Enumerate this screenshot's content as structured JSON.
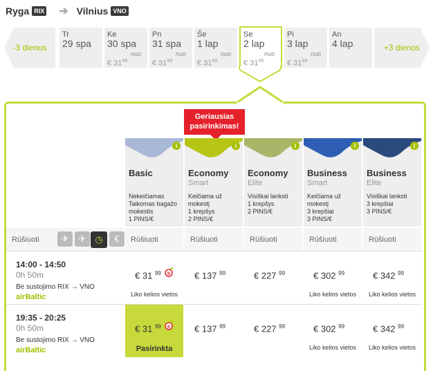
{
  "route": {
    "from": "Ryga",
    "from_code": "RIX",
    "to": "Vilnius",
    "to_code": "VNO"
  },
  "dates": {
    "prev_label": "-3 dienos",
    "next_label": "+3 dienos",
    "days": [
      {
        "dn": "Tr",
        "dd": "29 spa",
        "nuo": "",
        "price": "",
        "sup": ""
      },
      {
        "dn": "Ke",
        "dd": "30 spa",
        "nuo": "nuo",
        "price": "€ 31",
        "sup": "99"
      },
      {
        "dn": "Pn",
        "dd": "31 spa",
        "nuo": "nuo",
        "price": "€ 31",
        "sup": "99"
      },
      {
        "dn": "Še",
        "dd": "1 lap",
        "nuo": "nuo",
        "price": "€ 31",
        "sup": "99"
      },
      {
        "dn": "Se",
        "dd": "2 lap",
        "nuo": "nuo",
        "price": "€ 31",
        "sup": "99"
      },
      {
        "dn": "Pi",
        "dd": "3 lap",
        "nuo": "nuo",
        "price": "€ 31",
        "sup": "99"
      },
      {
        "dn": "An",
        "dd": "4 lap",
        "nuo": "",
        "price": "",
        "sup": ""
      }
    ]
  },
  "best_badge": "Geriausias pasirinkimas!",
  "fares": [
    {
      "name": "Basic",
      "sub": "",
      "features": "Nekeičiamas\nTaikomas bagažo\nmokestis\n1 PINS/€",
      "color": "#aab8d8"
    },
    {
      "name": "Economy",
      "sub": "Smart",
      "features": "Keičiama už\nmokestį\n1 krepšys\n2 PINS/€",
      "color": "#b7c616"
    },
    {
      "name": "Economy",
      "sub": "Elite",
      "features": "Visiškai lanksti\n1 krepšys\n2 PINS/€",
      "color": "#a9b66a"
    },
    {
      "name": "Business",
      "sub": "Smart",
      "features": "Keičiama už\nmokestį\n3 krepšiai\n3 PINS/€",
      "color": "#2f5fb5"
    },
    {
      "name": "Business",
      "sub": "Elite",
      "features": "Visiškai lanksti\n3 krepšiai\n3 PINS/€",
      "color": "#2a4a7e"
    }
  ],
  "sort": {
    "label": "Rūšiuoti",
    "icons": [
      "departure-icon",
      "arrival-icon",
      "clock-icon",
      "euro-icon"
    ],
    "cell_label": "Rūšiuoti"
  },
  "flights": [
    {
      "time": "14:00 - 14:50",
      "dur": "0h 50m",
      "stops": "Be sustojimo RIX → VNO",
      "airline": "airBaltic",
      "prices": [
        {
          "p": "€ 31",
          "s": "99",
          "note": "",
          "eco": true,
          "picked": false
        },
        {
          "p": "€ 137",
          "s": "99",
          "note": "",
          "eco": false,
          "picked": false
        },
        {
          "p": "€ 227",
          "s": "99",
          "note": "",
          "eco": false,
          "picked": false
        },
        {
          "p": "€ 302",
          "s": "99",
          "note": "Liko kelios vietos",
          "eco": false,
          "picked": false
        },
        {
          "p": "€ 342",
          "s": "99",
          "note": "Liko kelios vietos",
          "eco": false,
          "picked": false
        }
      ],
      "first_note": "Liko kelios vietos"
    },
    {
      "time": "19:35 - 20:25",
      "dur": "0h 50m",
      "stops": "Be sustojimo RIX → VNO",
      "airline": "airBaltic",
      "prices": [
        {
          "p": "€ 31",
          "s": "99",
          "note": "Pasirinkta",
          "eco": true,
          "picked": true
        },
        {
          "p": "€ 137",
          "s": "99",
          "note": "",
          "eco": false,
          "picked": false
        },
        {
          "p": "€ 227",
          "s": "99",
          "note": "",
          "eco": false,
          "picked": false
        },
        {
          "p": "€ 302",
          "s": "99",
          "note": "Liko kelios vietos",
          "eco": false,
          "picked": false
        },
        {
          "p": "€ 342",
          "s": "99",
          "note": "Liko kelios vietos",
          "eco": false,
          "picked": false
        }
      ],
      "first_note": ""
    }
  ]
}
